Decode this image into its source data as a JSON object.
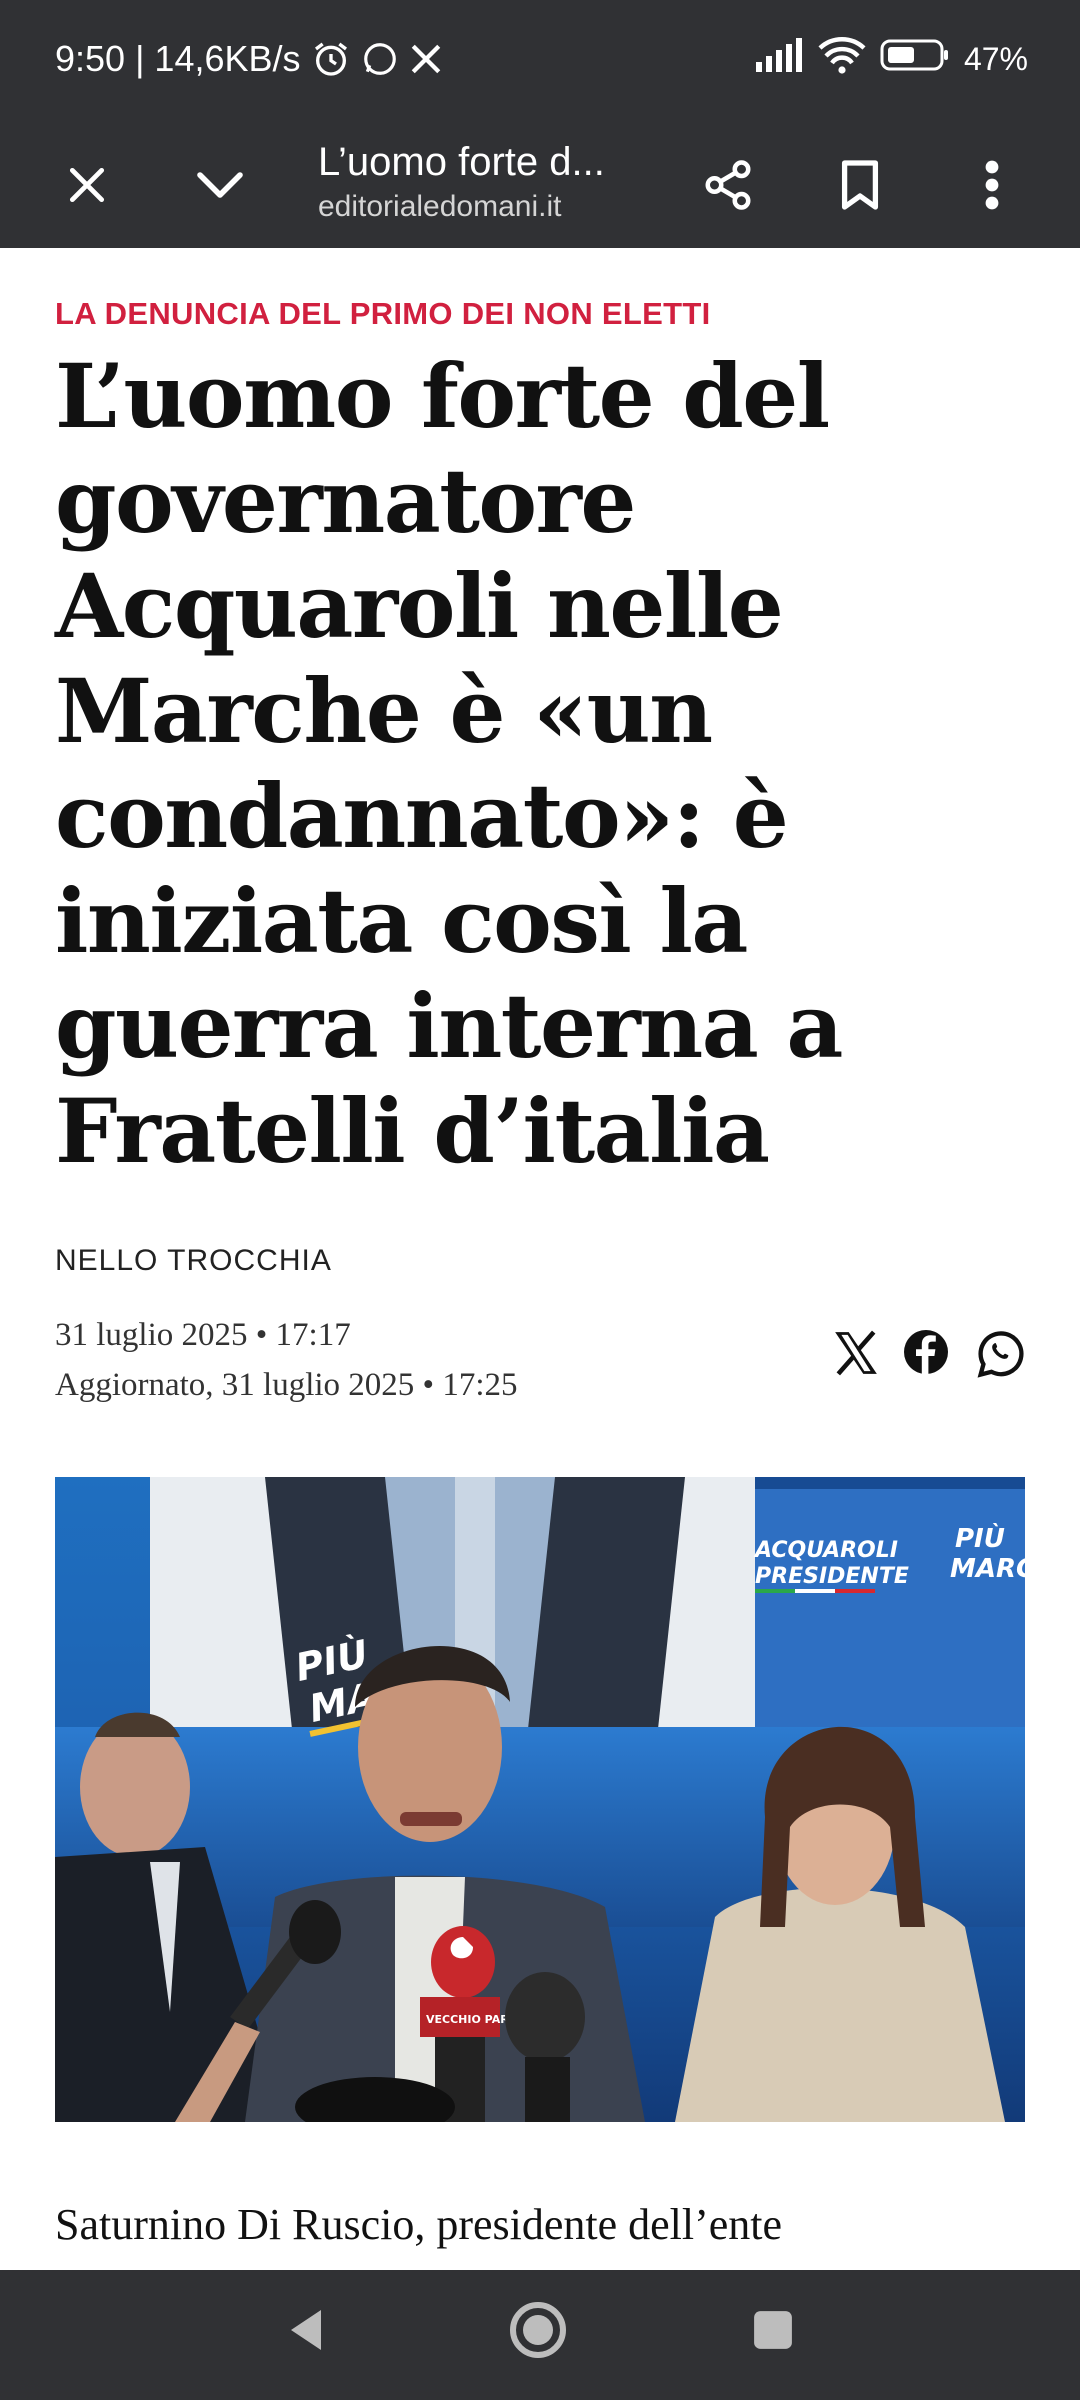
{
  "status_bar": {
    "time_speed": "9:50 | 14,6KB/s",
    "battery": "47%"
  },
  "toolbar": {
    "title": "L’uomo forte d...",
    "url": "editorialedomani.it"
  },
  "article": {
    "kicker": "LA DENUNCIA DEL PRIMO DEI NON ELETTI",
    "headline": "L’uomo forte del governatore Acquaroli nelle Marche è «un condannato»: è iniziata così la guerra interna a Fratelli d’italia",
    "author": "NELLO TROCCHIA",
    "published": "31 luglio 2025 • 17:17",
    "updated": "Aggiornato, 31 luglio 2025 • 17:25",
    "body_start": "Saturnino Di Ruscio, presidente dell’ente"
  },
  "photo": {
    "banner_left_line1": "PIÙ",
    "banner_left_line2": "MARCHE",
    "banner_right_line1": "ACQUAROLI",
    "banner_right_line2": "PRESIDENTE",
    "banner_far_line1": "PIÙ",
    "banner_far_line2": "MARC",
    "mic_label": "VECCHIO PARLA"
  },
  "colors": {
    "chrome_bg": "#303134",
    "kicker": "#d1203f"
  },
  "icons": [
    "close-icon",
    "chevron-down-icon",
    "share-icon",
    "bookmark-icon",
    "more-vert-icon",
    "x-logo-icon",
    "facebook-icon",
    "whatsapp-icon",
    "back-icon",
    "home-icon",
    "recents-icon"
  ]
}
